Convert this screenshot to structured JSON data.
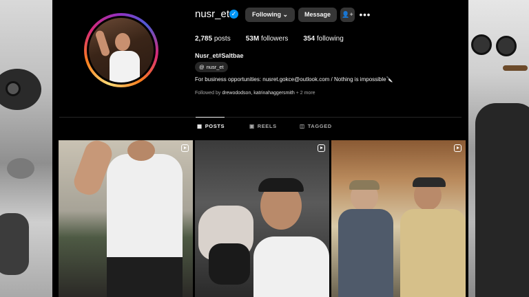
{
  "profile": {
    "username": "nusr_et",
    "verified_icon": "✓",
    "buttons": {
      "following": "Following ⌄",
      "message": "Message",
      "add_user_icon": "👤+",
      "more_icon": "•••"
    },
    "stats": {
      "posts_count": "2,785",
      "posts_label": "posts",
      "followers_count": "53M",
      "followers_label": "followers",
      "following_count": "354",
      "following_label": "following"
    },
    "full_name": "Nusr_et#Saltbae",
    "threads_badge": "nusr_et",
    "threads_icon": "@",
    "bio": "For business opportunities: nusret.gokce@outlook.com / Nothing is impossible🔪",
    "followed_by_prefix": "Followed by",
    "followed_by_names": "drewododson, katrinahaggersmith",
    "followed_by_more": "+ 2 more"
  },
  "tabs": [
    {
      "label": "POSTS",
      "icon": "▦",
      "active": true
    },
    {
      "label": "REELS",
      "icon": "▣",
      "active": false
    },
    {
      "label": "TAGGED",
      "icon": "◫",
      "active": false
    }
  ],
  "posts": [
    {
      "type": "reel"
    },
    {
      "type": "reel"
    },
    {
      "type": "reel"
    }
  ],
  "colors": {
    "background": "#000000",
    "button": "#363636",
    "verified": "#0095f6",
    "muted_text": "#a8a8a8"
  }
}
